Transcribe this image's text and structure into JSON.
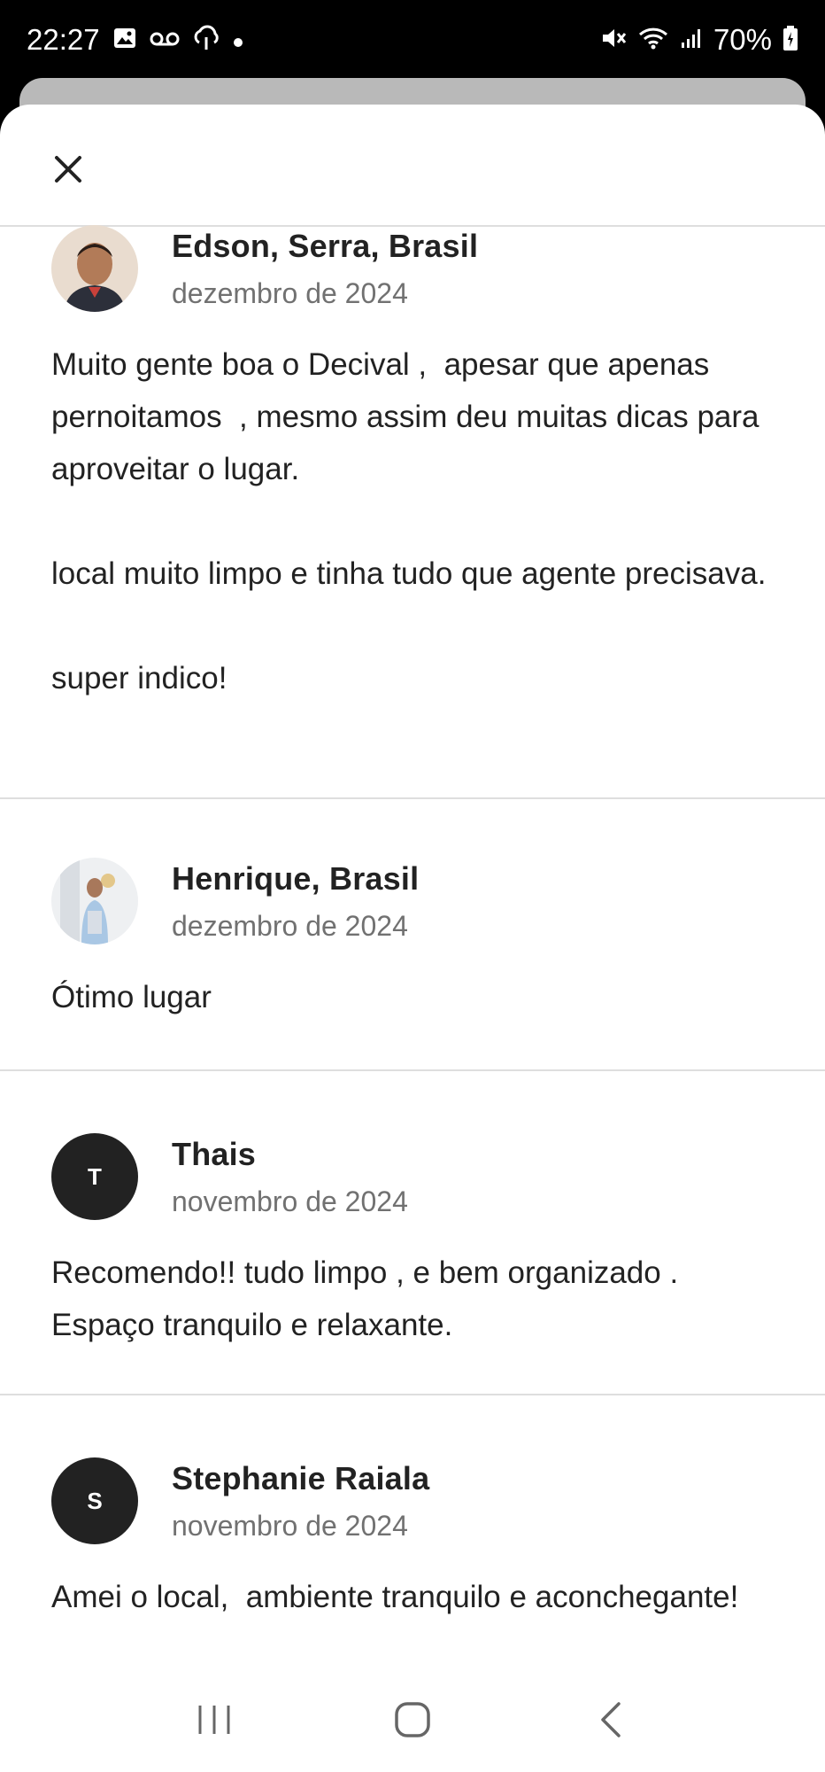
{
  "status_bar": {
    "time": "22:27",
    "battery": "70%",
    "icons_left": [
      "image-icon",
      "voicemail-icon",
      "cloud-icon",
      "dot-icon"
    ],
    "icons_right": [
      "mute-icon",
      "wifi-icon",
      "signal-icon",
      "battery-icon"
    ]
  },
  "sheet": {
    "close_icon": "close-icon"
  },
  "reviews": [
    {
      "name": "Edson, Serra, Brasil",
      "date": "dezembro de 2024",
      "avatar": "photo",
      "text": "Muito gente boa o Decival ,  apesar que apenas pernoitamos  , mesmo assim deu muitas dicas para aproveitar o lugar.\n\nlocal muito limpo e tinha tudo que agente precisava.\n\nsuper indico!"
    },
    {
      "name": "Henrique, Brasil",
      "date": "dezembro de 2024",
      "avatar": "photo",
      "text": "Ótimo lugar"
    },
    {
      "name": "Thais",
      "date": "novembro de 2024",
      "avatar_letter": "T",
      "text": "Recomendo!! tudo limpo , e bem organizado . Espaço tranquilo e relaxante."
    },
    {
      "name": "Stephanie Raiala",
      "date": "novembro de 2024",
      "avatar_letter": "S",
      "text": "Amei o local,  ambiente tranquilo e aconchegante!"
    }
  ],
  "nav_bar": {
    "icons": [
      "recent-apps-icon",
      "home-icon",
      "back-icon"
    ]
  },
  "colors": {
    "text_primary": "#222222",
    "text_secondary": "#717171",
    "divider": "#dedede",
    "letter_avatar_bg": "#222222"
  }
}
